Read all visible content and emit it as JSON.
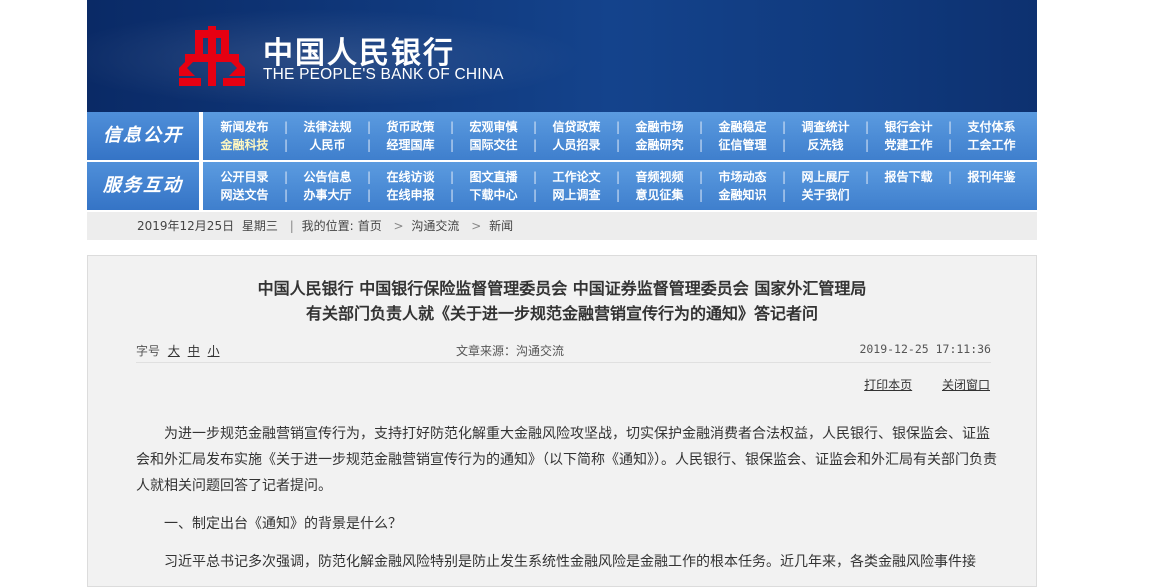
{
  "header": {
    "bank_name_cn": "中国人民银行",
    "bank_name_en": "THE PEOPLE'S BANK OF CHINA",
    "colors": {
      "banner": "#14438c",
      "emblem": "#e60012",
      "nav": "#4a8ad6"
    }
  },
  "nav": {
    "info": {
      "label": "信息公开",
      "row1": [
        "新闻发布",
        "法律法规",
        "货币政策",
        "宏观审慎",
        "信贷政策",
        "金融市场",
        "金融稳定",
        "调查统计",
        "银行会计",
        "支付体系"
      ],
      "row2": [
        "金融科技",
        "人民币",
        "经理国库",
        "国际交往",
        "人员招录",
        "金融研究",
        "征信管理",
        "反洗钱",
        "党建工作",
        "工会工作"
      ]
    },
    "service": {
      "label": "服务互动",
      "row1": [
        "公开目录",
        "公告信息",
        "在线访谈",
        "图文直播",
        "工作论文",
        "音频视频",
        "市场动态",
        "网上展厅",
        "报告下载",
        "报刊年鉴"
      ],
      "row2": [
        "网送文告",
        "办事大厅",
        "在线申报",
        "下载中心",
        "网上调查",
        "意见征集",
        "金融知识",
        "关于我们"
      ]
    }
  },
  "breadcrumb": {
    "date": "2019年12月25日",
    "weekday": "星期三",
    "location_label": "我的位置:",
    "home": "首页",
    "level1": "沟通交流",
    "level2": "新闻",
    "sep": ">"
  },
  "article": {
    "title_line1": "中国人民银行  中国银行保险监督管理委员会  中国证券监督管理委员会  国家外汇管理局",
    "title_line2": "有关部门负责人就《关于进一步规范金融营销宣传行为的通知》答记者问",
    "font_size_label": "字号",
    "font_sizes": [
      "大",
      "中",
      "小"
    ],
    "source": "文章来源：沟通交流",
    "datetime": "2019-12-25  17:11:36",
    "print_link": "打印本页",
    "close_link": "关闭窗口",
    "paragraphs": [
      "为进一步规范金融营销宣传行为，支持打好防范化解重大金融风险攻坚战，切实保护金融消费者合法权益，人民银行、银保监会、证监会和外汇局发布实施《关于进一步规范金融营销宣传行为的通知》（以下简称《通知》）。人民银行、银保监会、证监会和外汇局有关部门负责人就相关问题回答了记者提问。",
      "一、制定出台《通知》的背景是什么？",
      "习近平总书记多次强调，防范化解金融风险特别是防止发生系统性金融风险是金融工作的根本任务。近几年来，各类金融风险事件接"
    ]
  }
}
